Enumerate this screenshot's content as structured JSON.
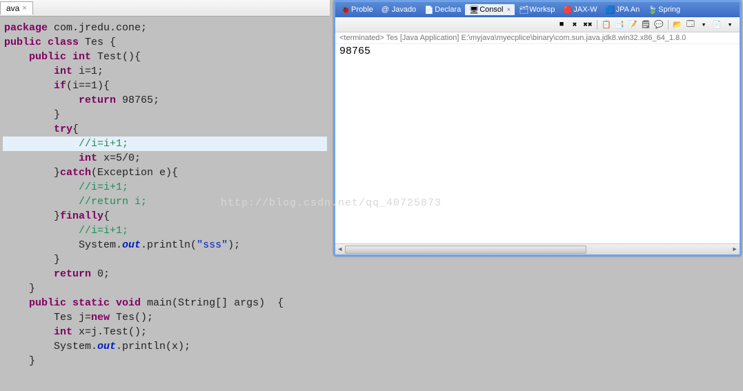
{
  "editor": {
    "tab_label": "ava",
    "code_lines": [
      {
        "hl": false,
        "tokens": [
          {
            "t": "kw",
            "v": "package"
          },
          {
            "t": "id",
            "v": " com.jredu.cone;"
          }
        ]
      },
      {
        "hl": false,
        "tokens": [
          {
            "t": "id",
            "v": ""
          }
        ]
      },
      {
        "hl": false,
        "tokens": [
          {
            "t": "kw",
            "v": "public class"
          },
          {
            "t": "id",
            "v": " Tes {"
          }
        ]
      },
      {
        "hl": false,
        "tokens": [
          {
            "t": "id",
            "v": "    "
          },
          {
            "t": "kw",
            "v": "public int"
          },
          {
            "t": "id",
            "v": " Test(){"
          }
        ]
      },
      {
        "hl": false,
        "tokens": [
          {
            "t": "id",
            "v": "        "
          },
          {
            "t": "kw",
            "v": "int"
          },
          {
            "t": "id",
            "v": " i=1;"
          }
        ]
      },
      {
        "hl": false,
        "tokens": [
          {
            "t": "id",
            "v": "        "
          },
          {
            "t": "kw",
            "v": "if"
          },
          {
            "t": "id",
            "v": "(i==1){"
          }
        ]
      },
      {
        "hl": false,
        "tokens": [
          {
            "t": "id",
            "v": "            "
          },
          {
            "t": "kw",
            "v": "return"
          },
          {
            "t": "id",
            "v": " 98765;"
          }
        ]
      },
      {
        "hl": false,
        "tokens": [
          {
            "t": "id",
            "v": "        }"
          }
        ]
      },
      {
        "hl": false,
        "tokens": [
          {
            "t": "id",
            "v": "        "
          },
          {
            "t": "kw",
            "v": "try"
          },
          {
            "t": "id",
            "v": "{"
          }
        ]
      },
      {
        "hl": true,
        "tokens": [
          {
            "t": "id",
            "v": "            "
          },
          {
            "t": "com",
            "v": "//i=i+1;"
          }
        ]
      },
      {
        "hl": false,
        "tokens": [
          {
            "t": "id",
            "v": "            "
          },
          {
            "t": "kw",
            "v": "int"
          },
          {
            "t": "id",
            "v": " x=5/0;"
          }
        ]
      },
      {
        "hl": false,
        "tokens": [
          {
            "t": "id",
            "v": "        }"
          },
          {
            "t": "kw",
            "v": "catch"
          },
          {
            "t": "id",
            "v": "(Exception e){"
          }
        ]
      },
      {
        "hl": false,
        "tokens": [
          {
            "t": "id",
            "v": "            "
          },
          {
            "t": "com",
            "v": "//i=i+1;"
          }
        ]
      },
      {
        "hl": false,
        "tokens": [
          {
            "t": "id",
            "v": "            "
          },
          {
            "t": "com",
            "v": "//return i;"
          }
        ]
      },
      {
        "hl": false,
        "tokens": [
          {
            "t": "id",
            "v": "        }"
          },
          {
            "t": "kw",
            "v": "finally"
          },
          {
            "t": "id",
            "v": "{"
          }
        ]
      },
      {
        "hl": false,
        "tokens": [
          {
            "t": "id",
            "v": "            "
          },
          {
            "t": "com",
            "v": "//i=i+1;"
          }
        ]
      },
      {
        "hl": false,
        "tokens": [
          {
            "t": "id",
            "v": "            System."
          },
          {
            "t": "fld",
            "v": "out"
          },
          {
            "t": "id",
            "v": ".println("
          },
          {
            "t": "str",
            "v": "\"sss\""
          },
          {
            "t": "id",
            "v": ");"
          }
        ]
      },
      {
        "hl": false,
        "tokens": [
          {
            "t": "id",
            "v": "        }"
          }
        ]
      },
      {
        "hl": false,
        "tokens": [
          {
            "t": "id",
            "v": "        "
          },
          {
            "t": "kw",
            "v": "return"
          },
          {
            "t": "id",
            "v": " 0;"
          }
        ]
      },
      {
        "hl": false,
        "tokens": [
          {
            "t": "id",
            "v": "    }"
          }
        ]
      },
      {
        "hl": false,
        "tokens": [
          {
            "t": "id",
            "v": "    "
          },
          {
            "t": "kw",
            "v": "public static void"
          },
          {
            "t": "id",
            "v": " main(String[] args)  {"
          }
        ]
      },
      {
        "hl": false,
        "tokens": [
          {
            "t": "id",
            "v": "        Tes j="
          },
          {
            "t": "kw",
            "v": "new"
          },
          {
            "t": "id",
            "v": " Tes();"
          }
        ]
      },
      {
        "hl": false,
        "tokens": [
          {
            "t": "id",
            "v": "        "
          },
          {
            "t": "kw",
            "v": "int"
          },
          {
            "t": "id",
            "v": " x=j.Test();"
          }
        ]
      },
      {
        "hl": false,
        "tokens": [
          {
            "t": "id",
            "v": "        System."
          },
          {
            "t": "fld",
            "v": "out"
          },
          {
            "t": "id",
            "v": ".println(x);"
          }
        ]
      },
      {
        "hl": false,
        "tokens": [
          {
            "t": "id",
            "v": "    }"
          }
        ]
      }
    ]
  },
  "console": {
    "view_tabs": [
      {
        "icon": "🐞",
        "label": "Proble",
        "active": false
      },
      {
        "icon": "@",
        "label": "Javado",
        "active": false
      },
      {
        "icon": "📄",
        "label": "Declara",
        "active": false
      },
      {
        "icon": "🖥",
        "label": "Consol",
        "active": true
      },
      {
        "icon": "🗂",
        "label": "Worksp",
        "active": false
      },
      {
        "icon": "🔴",
        "label": "JAX-W",
        "active": false
      },
      {
        "icon": "🟦",
        "label": "JPA An",
        "active": false
      },
      {
        "icon": "🍃",
        "label": "Spring",
        "active": false
      }
    ],
    "toolbar_icons": [
      "■",
      "✖",
      "✖✖",
      "|",
      "📋",
      "📑",
      "📝",
      "🗒",
      "💬",
      "|",
      "📂",
      "🗔",
      "▾",
      "📄",
      "▾"
    ],
    "terminated_line": "<terminated> Tes [Java Application] E:\\myjava\\myecplice\\binary\\com.sun.java.jdk8.win32.x86_64_1.8.0",
    "output": "98765"
  },
  "watermark": "http://blog.csdn.net/qq_40725873"
}
